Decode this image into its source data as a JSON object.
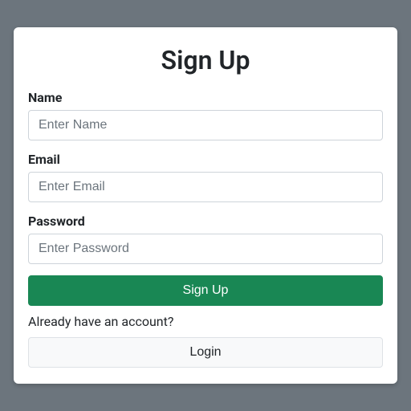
{
  "title": "Sign Up",
  "fields": {
    "name": {
      "label": "Name",
      "placeholder": "Enter Name",
      "value": ""
    },
    "email": {
      "label": "Email",
      "placeholder": "Enter Email",
      "value": ""
    },
    "password": {
      "label": "Password",
      "placeholder": "Enter Password",
      "value": ""
    }
  },
  "submit_label": "Sign Up",
  "helper_text": "Already have an account?",
  "login_label": "Login",
  "colors": {
    "primary": "#198754",
    "page_bg": "#6c757d"
  }
}
